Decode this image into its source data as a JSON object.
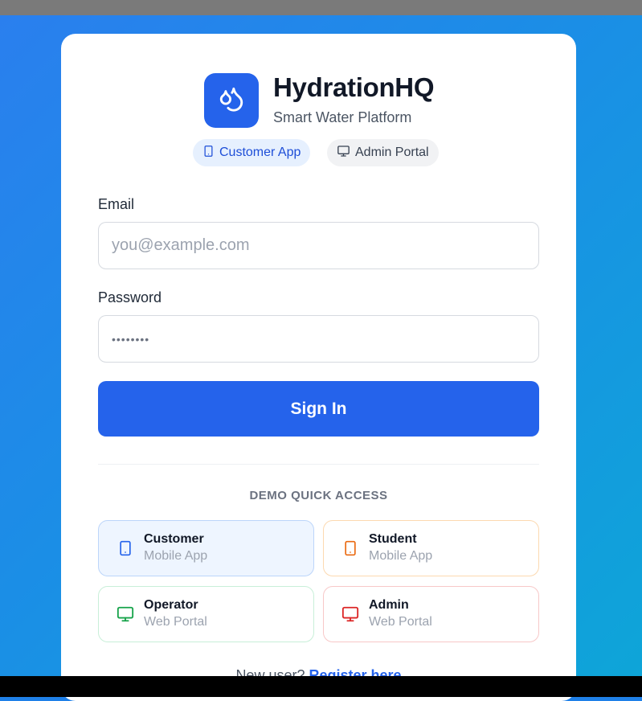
{
  "brand": {
    "name": "HydrationHQ",
    "subtitle": "Smart Water Platform",
    "logo_icon": "droplets-icon",
    "accent": "#2563eb"
  },
  "app_switch": [
    {
      "label": "Customer App",
      "icon": "smartphone-icon",
      "active": true
    },
    {
      "label": "Admin Portal",
      "icon": "monitor-icon",
      "active": false
    }
  ],
  "form": {
    "email_label": "Email",
    "email_placeholder": "you@example.com",
    "email_value": "",
    "password_label": "Password",
    "password_value": "••••••••",
    "submit_label": "Sign In"
  },
  "demo": {
    "title": "DEMO QUICK ACCESS",
    "tiles": [
      {
        "name": "Customer",
        "sub": "Mobile App",
        "icon": "smartphone-icon",
        "color": "#2563eb"
      },
      {
        "name": "Student",
        "sub": "Mobile App",
        "icon": "smartphone-icon",
        "color": "#ea6a12"
      },
      {
        "name": "Operator",
        "sub": "Web Portal",
        "icon": "monitor-icon",
        "color": "#16a34a"
      },
      {
        "name": "Admin",
        "sub": "Web Portal",
        "icon": "monitor-icon",
        "color": "#dc2626"
      }
    ]
  },
  "footer": {
    "prompt": "New user?",
    "link": "Register here"
  }
}
